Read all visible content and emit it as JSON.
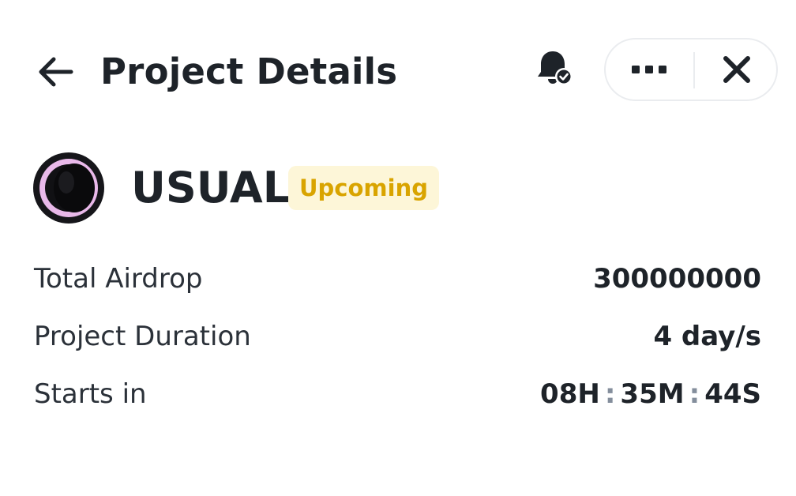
{
  "header": {
    "title": "Project Details",
    "icons": {
      "back": "arrow-left-icon",
      "bell": "bell-check-icon",
      "more": "more-horizontal-icon",
      "close": "close-icon"
    }
  },
  "project": {
    "name": "USUAL",
    "status": "Upcoming",
    "logo": "usual-logo",
    "colors": {
      "badge_bg": "#fdf6d8",
      "badge_text": "#d9a400",
      "logo_ring": "#e9b9ea"
    }
  },
  "details": {
    "total_airdrop": {
      "label": "Total Airdrop",
      "value": "300000000"
    },
    "project_duration": {
      "label": "Project Duration",
      "value": "4 day/s"
    },
    "starts_in": {
      "label": "Starts in",
      "hours": "08H",
      "minutes": "35M",
      "seconds": "44S",
      "separator": ":"
    }
  }
}
